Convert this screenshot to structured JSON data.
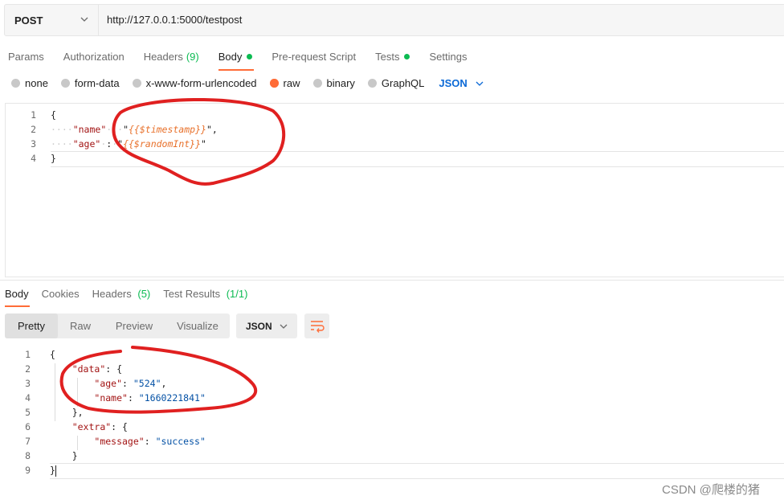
{
  "request": {
    "method": "POST",
    "url": "http://127.0.0.1:5000/testpost"
  },
  "tabs": {
    "params": "Params",
    "authorization": "Authorization",
    "headers": "Headers",
    "headers_count": "(9)",
    "body": "Body",
    "prerequest": "Pre-request Script",
    "tests": "Tests",
    "settings": "Settings"
  },
  "body_types": {
    "none": "none",
    "form_data": "form-data",
    "urlencoded": "x-www-form-urlencoded",
    "raw": "raw",
    "binary": "binary",
    "graphql": "GraphQL",
    "format": "JSON",
    "selected": "raw"
  },
  "request_body": {
    "line_numbers": [
      "1",
      "2",
      "3",
      "4"
    ],
    "open": "{",
    "close": "}",
    "name_key": "\"name\"",
    "name_value": "{{$timestamp}}",
    "age_key": "\"age\"",
    "age_value": "{{$randomInt}}"
  },
  "response_tabs": {
    "body": "Body",
    "cookies": "Cookies",
    "headers": "Headers",
    "headers_count": "(5)",
    "test_results": "Test Results",
    "test_results_count": "(1/1)"
  },
  "view_modes": {
    "pretty": "Pretty",
    "raw": "Raw",
    "preview": "Preview",
    "visualize": "Visualize",
    "format": "JSON"
  },
  "response_body": {
    "line_numbers": [
      "1",
      "2",
      "3",
      "4",
      "5",
      "6",
      "7",
      "8",
      "9"
    ],
    "data_key": "\"data\"",
    "age_key": "\"age\"",
    "age_value": "\"524\"",
    "name_key": "\"name\"",
    "name_value": "\"1660221841\"",
    "extra_key": "\"extra\"",
    "message_key": "\"message\"",
    "message_value": "\"success\""
  },
  "watermark": "CSDN @爬楼的猪",
  "colors": {
    "accent": "#ff6c37",
    "status_green": "#0cbb52",
    "link_blue": "#0b69d6",
    "annotation_red": "#e02020"
  }
}
